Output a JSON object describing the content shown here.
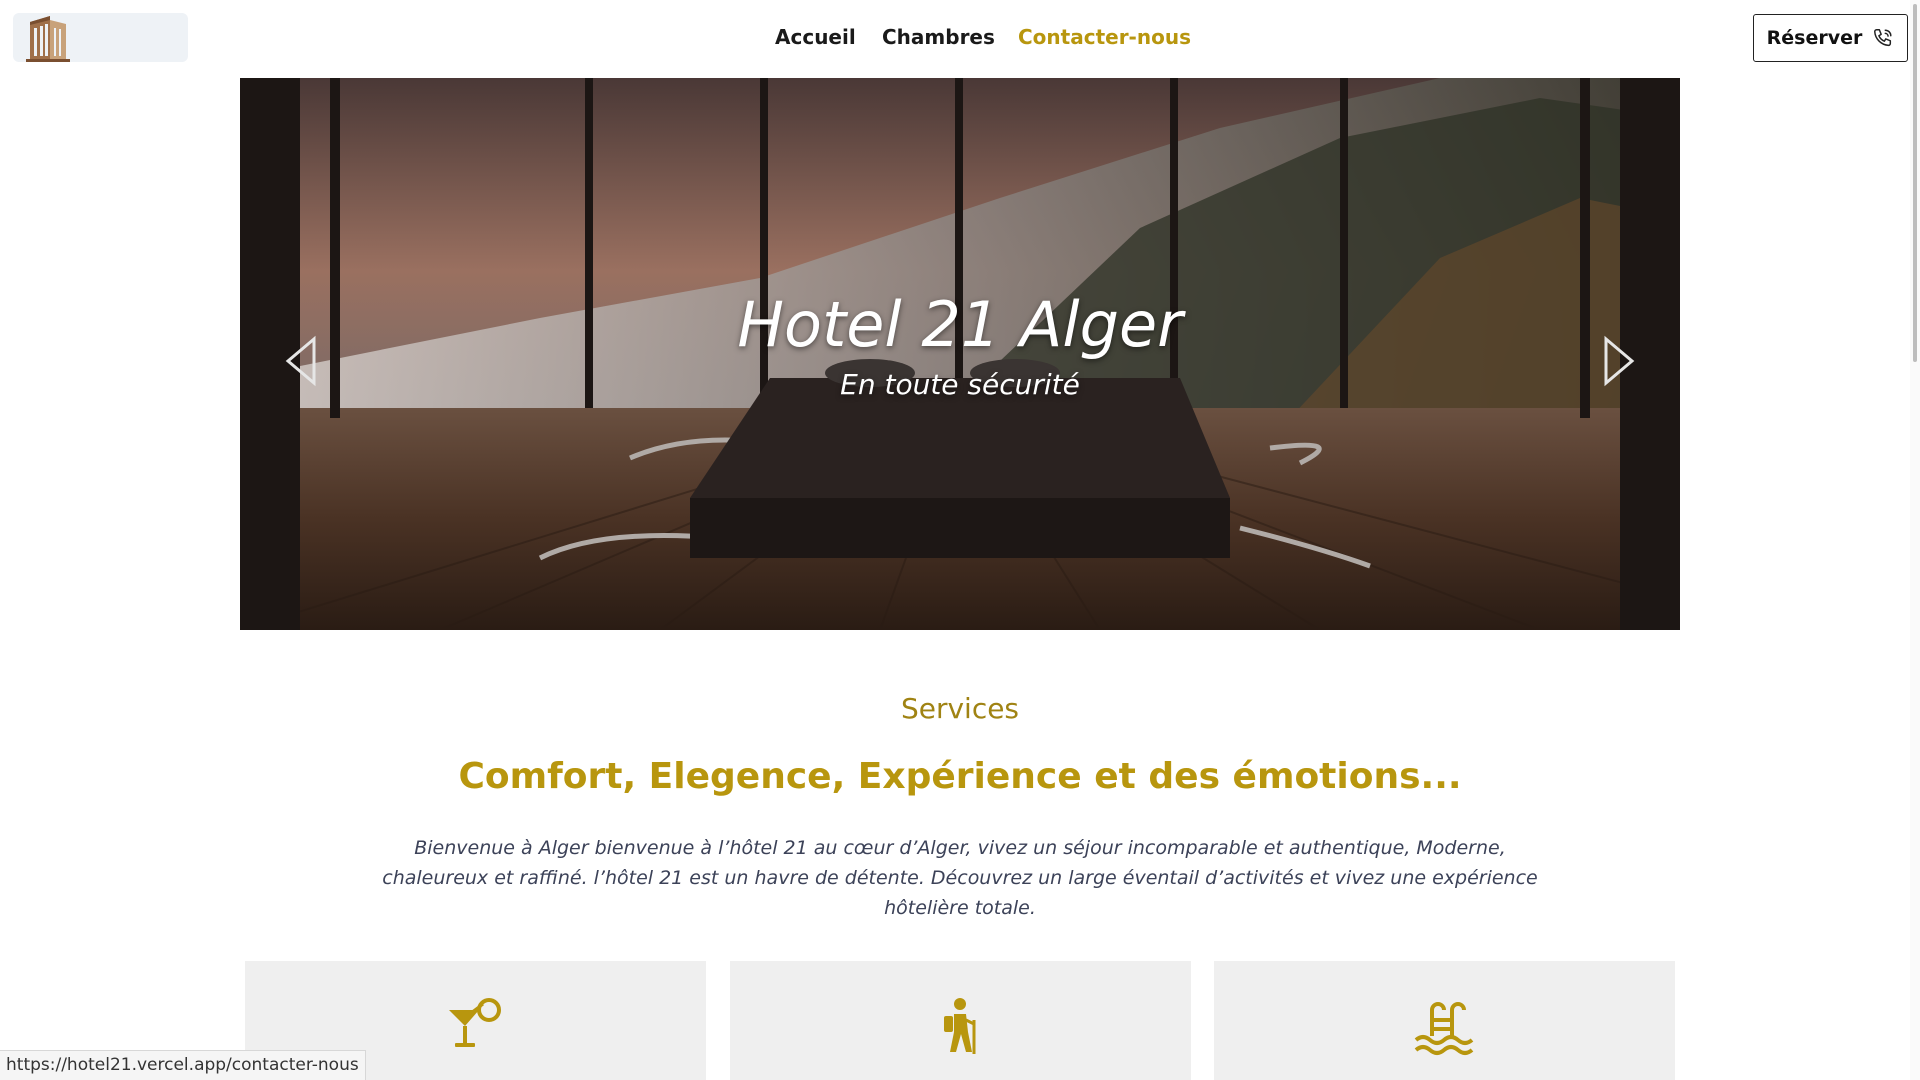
{
  "header": {
    "nav": [
      {
        "label": "Accueil"
      },
      {
        "label": "Chambres"
      },
      {
        "label": "Contacter-nous",
        "active": true
      }
    ],
    "reserve_label": "Réserver",
    "reserve_icon": "phone-call-icon",
    "logo_icon": "hotel-building-icon"
  },
  "hero": {
    "title": "Hotel 21 Alger",
    "subtitle": "En toute sécurité",
    "prev_icon": "chevron-left-icon",
    "next_icon": "chevron-right-icon"
  },
  "services": {
    "label": "Services",
    "heading": "Comfort, Elegence, Expérience et des émotions...",
    "description": "Bienvenue à Alger bienvenue à l’hôtel 21 au cœur d’Alger, vivez un séjour incomparable et authentique, Moderne, chaleureux et raffiné. l’hôtel 21 est un havre de détente. Découvrez un large éventail d’activités et vivez une expérience hôtelière totale.",
    "cards": [
      {
        "icon": "cocktail-icon"
      },
      {
        "icon": "hiking-icon"
      },
      {
        "icon": "swimming-pool-icon"
      }
    ]
  },
  "status_bar": {
    "url": "https://hotel21.vercel.app/contacter-nous"
  },
  "colors": {
    "accent": "#b8960e",
    "text_dark": "#1a1a1a",
    "card_bg": "#efefef"
  }
}
